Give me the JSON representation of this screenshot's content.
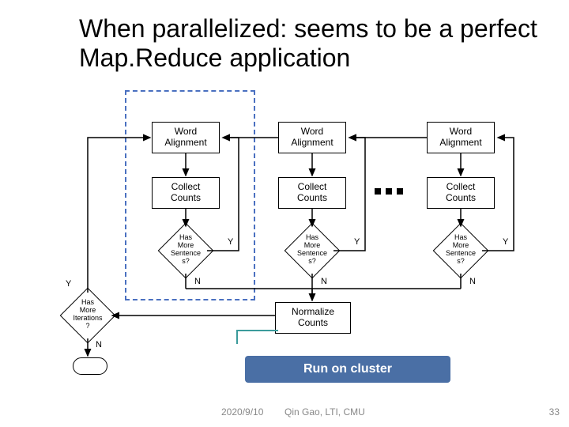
{
  "title": "When parallelized: seems to be a perfect Map.Reduce application",
  "nodes": {
    "word_alignment": "Word\nAlignment",
    "collect_counts": "Collect\nCounts",
    "has_more_sentences": "Has\nMore\nSentence\ns?",
    "has_more_iterations": "Has\nMore\nIterations\n?",
    "normalize_counts": "Normalize\nCounts"
  },
  "labels": {
    "yes": "Y",
    "no": "N"
  },
  "banner": "Run on cluster",
  "footer": {
    "date": "2020/9/10",
    "author": "Qin Gao, LTI, CMU",
    "page": "33"
  }
}
